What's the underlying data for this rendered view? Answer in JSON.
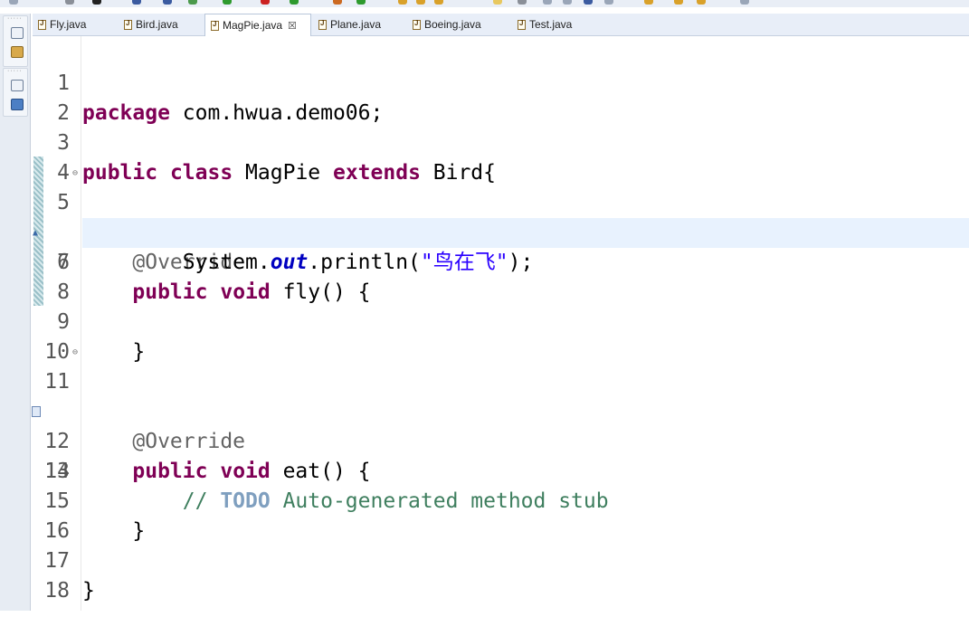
{
  "tabs": [
    {
      "label": "Fly.java",
      "active": false
    },
    {
      "label": "Bird.java",
      "active": false
    },
    {
      "label": "MagPie.java",
      "active": true,
      "close": "☒"
    },
    {
      "label": "Plane.java",
      "active": false
    },
    {
      "label": "Boeing.java",
      "active": false
    },
    {
      "label": "Test.java",
      "active": false
    }
  ],
  "editor": {
    "current_line": 7,
    "lines": [
      {
        "n": "1"
      },
      {
        "n": "2"
      },
      {
        "n": "3"
      },
      {
        "n": "4"
      },
      {
        "n": "5"
      },
      {
        "n": "6"
      },
      {
        "n": "7"
      },
      {
        "n": "8"
      },
      {
        "n": "9"
      },
      {
        "n": "10"
      },
      {
        "n": "11"
      },
      {
        "n": "12"
      },
      {
        "n": "13"
      },
      {
        "n": "14"
      },
      {
        "n": "15"
      },
      {
        "n": "16"
      },
      {
        "n": "17"
      },
      {
        "n": "18"
      }
    ],
    "code": {
      "l1_kw": "package",
      "l1_rest": " com.hwua.demo06;",
      "l3_kw1": "public",
      "l3_kw2": "class",
      "l3_name": " MagPie ",
      "l3_kw3": "extends",
      "l3_rest": " Bird{",
      "l5_ann": "@Override",
      "l6_kw1": "public",
      "l6_kw2": "void",
      "l6_rest": " fly() {",
      "l7_a": "System.",
      "l7_field": "out",
      "l7_b": ".println(",
      "l7_str": "\"鸟在飞\"",
      "l7_c": ");",
      "l9": "}",
      "l11_ann": "@Override",
      "l12_kw1": "public",
      "l12_kw2": "void",
      "l12_rest": " eat() {",
      "l13_slash": "// ",
      "l13_todo": "TODO",
      "l13_rest": " Auto-generated method stub",
      "l15": "}",
      "l17": "}"
    }
  },
  "colors": {
    "keyword": "#7f0055",
    "annotation": "#646464",
    "string": "#2a00ff",
    "static_field": "#0000c0",
    "comment": "#3f7f5f",
    "todo": "#7f9fbf",
    "current_line_bg": "#e8f2fe"
  },
  "icons": {
    "fold": "fold-minus-icon",
    "override": "override-indicator-icon",
    "task": "task-marker-icon"
  }
}
